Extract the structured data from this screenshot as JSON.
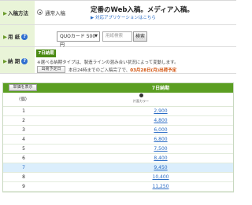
{
  "options": {
    "method_label": "入稿方法",
    "method_radio_label": "通常入稿",
    "headline": "定番のWeb入稿。メディア入稿。",
    "sublink": "▶ 対応アプリケーションはこちら",
    "paper_label": "用 紙",
    "paper_select": "QUOカード 500円",
    "paper_input_placeholder": "用紙検索",
    "search_button": "検索",
    "delivery_label": "納 期",
    "delivery_badge": "7日納期",
    "delivery_note": "※選べる納期タイプは、製造ラインの混み合い状況によって変動します。",
    "ship_button": "出荷予定日",
    "ship_text_prefix": "本日24時までのご入稿完了で、",
    "ship_date": "03月28日(月)出荷予定"
  },
  "price_table": {
    "single_button": "単価を表示",
    "column_title": "7日納期",
    "unit_label": "（個）",
    "logo_text": "片面カラー",
    "rows": [
      {
        "qty": "1",
        "price": "2,900"
      },
      {
        "qty": "2",
        "price": "4,800"
      },
      {
        "qty": "3",
        "price": "6,000"
      },
      {
        "qty": "4",
        "price": "6,800"
      },
      {
        "qty": "5",
        "price": "7,500"
      },
      {
        "qty": "6",
        "price": "8,400"
      },
      {
        "qty": "7",
        "price": "9,450"
      },
      {
        "qty": "8",
        "price": "10,400"
      },
      {
        "qty": "9",
        "price": "11,250"
      }
    ],
    "highlighted_row": 6
  }
}
